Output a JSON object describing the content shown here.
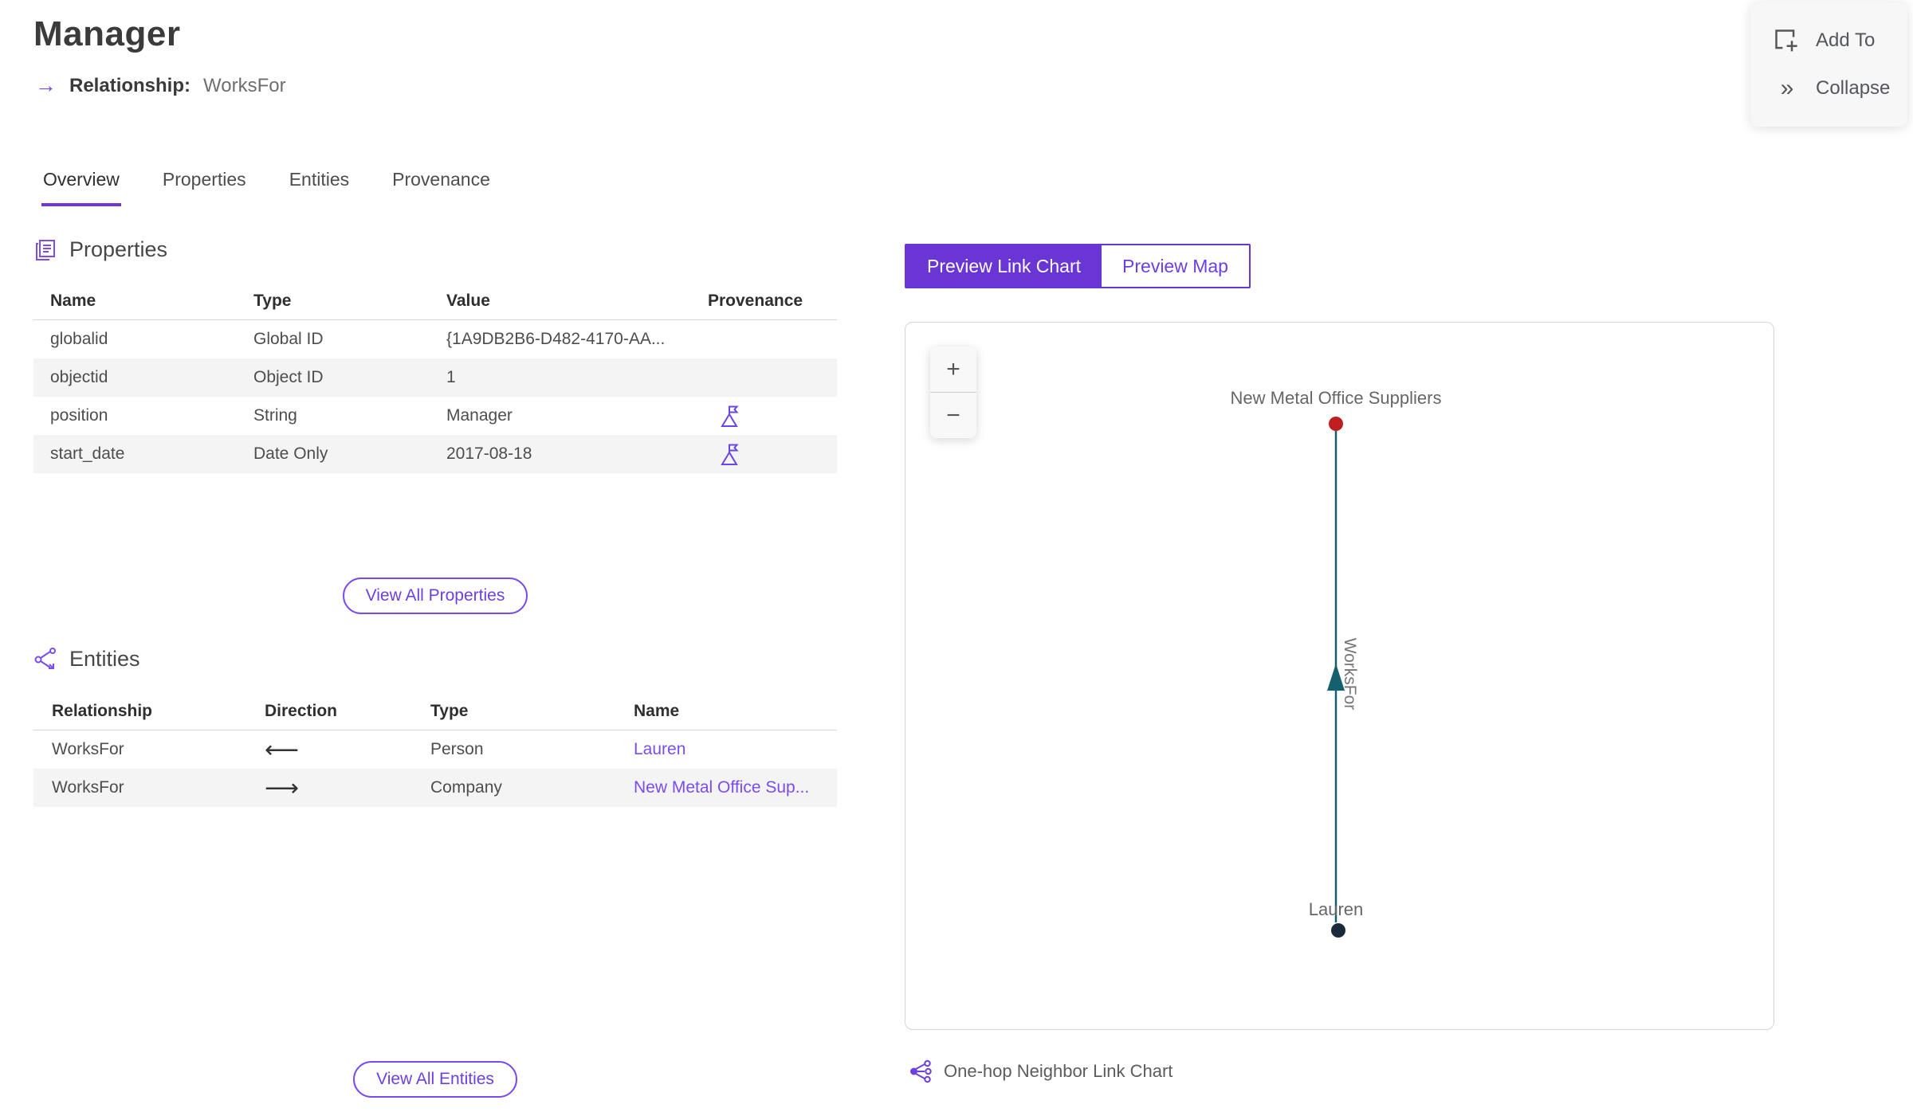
{
  "header": {
    "title": "Manager",
    "arrow": "→",
    "subtitle_label": "Relationship:",
    "subtitle_value": "WorksFor"
  },
  "actions": {
    "add_to": "Add To",
    "collapse": "Collapse",
    "collapse_glyph": "»"
  },
  "tabs": [
    {
      "label": "Overview",
      "active": true
    },
    {
      "label": "Properties",
      "active": false
    },
    {
      "label": "Entities",
      "active": false
    },
    {
      "label": "Provenance",
      "active": false
    }
  ],
  "properties_section": {
    "title": "Properties",
    "columns": [
      "Name",
      "Type",
      "Value",
      "Provenance"
    ],
    "rows": [
      {
        "name": "globalid",
        "type": "Global ID",
        "value": "{1A9DB2B6-D482-4170-AA...",
        "provenance": false
      },
      {
        "name": "objectid",
        "type": "Object ID",
        "value": "1",
        "provenance": false
      },
      {
        "name": "position",
        "type": "String",
        "value": "Manager",
        "provenance": true
      },
      {
        "name": "start_date",
        "type": "Date Only",
        "value": "2017-08-18",
        "provenance": true
      }
    ],
    "view_all_label": "View All Properties"
  },
  "entities_section": {
    "title": "Entities",
    "columns": [
      "Relationship",
      "Direction",
      "Type",
      "Name"
    ],
    "rows": [
      {
        "relationship": "WorksFor",
        "direction": "⟵",
        "type": "Person",
        "name": "Lauren"
      },
      {
        "relationship": "WorksFor",
        "direction": "⟶",
        "type": "Company",
        "name": "New Metal Office Sup..."
      }
    ],
    "view_all_label": "View All Entities"
  },
  "preview": {
    "toggle": [
      {
        "label": "Preview Link Chart",
        "active": true
      },
      {
        "label": "Preview Map",
        "active": false
      }
    ],
    "zoom_in": "+",
    "zoom_out": "−",
    "caption": "One-hop Neighbor Link Chart"
  },
  "chart_data": {
    "type": "link-chart",
    "nodes": [
      {
        "label": "New Metal Office Suppliers",
        "entity_type": "Company",
        "color": "#bf1f1f",
        "position": "top"
      },
      {
        "label": "Lauren",
        "entity_type": "Person",
        "color": "#1b2a3a",
        "position": "bottom"
      }
    ],
    "edges": [
      {
        "label": "WorksFor",
        "from": "Lauren",
        "to": "New Metal Office Suppliers",
        "color": "#15606e",
        "direction": "up"
      }
    ]
  },
  "colors": {
    "accent": "#6a35d5",
    "link": "#7b4cf0",
    "tab_underline": "#6d35e0",
    "edge_teal": "#15606e",
    "node_red": "#bf1f1f",
    "node_dark": "#1b2a3a",
    "alt_row": "#f4f4f4",
    "card_bg": "#f7f7f7"
  }
}
